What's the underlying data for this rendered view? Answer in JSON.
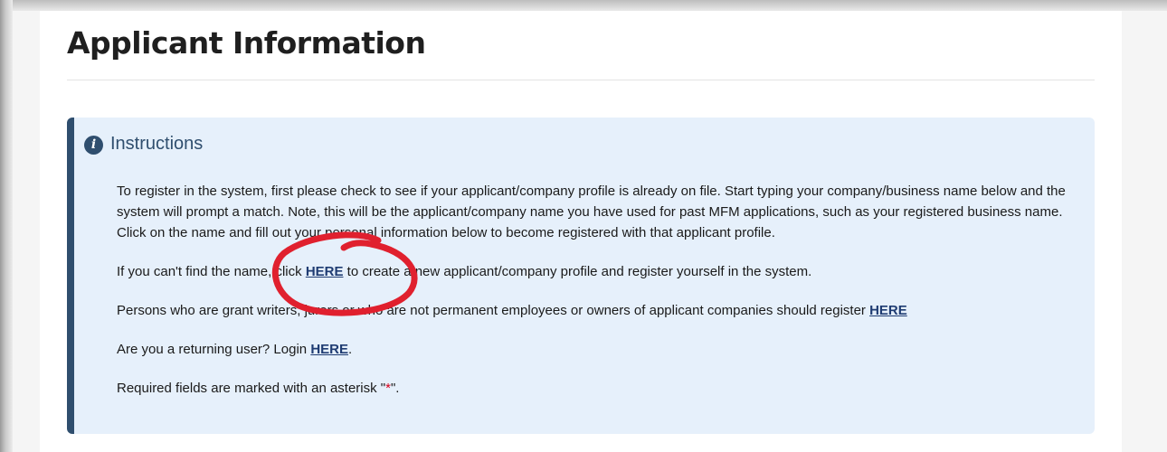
{
  "page": {
    "title": "Applicant Information"
  },
  "instructions": {
    "icon": "info-circle-icon",
    "heading": "Instructions",
    "paragraph1": "To register in the system, first please check to see if your applicant/company profile is already on file. Start typing your company/business name below and the system will prompt a match. Note, this will be the applicant/company name you have used for past MFM applications, such as your registered business name. Click on the name and fill out your personal information below to become registered with that applicant profile.",
    "paragraph2": {
      "before": "If you can't find the name, click ",
      "link": "HERE",
      "after": " to create a new applicant/company profile and register yourself in the system."
    },
    "paragraph3": {
      "before": "Persons who are grant writers, jurors or who are not permanent employees or owners of applicant companies should register ",
      "link": "HERE"
    },
    "paragraph4": {
      "before": "Are you a returning user? Login ",
      "link": "HERE",
      "after": "."
    },
    "paragraph5": {
      "before": "Required fields are marked with an asterisk \"",
      "star": "*",
      "after": "\"."
    }
  },
  "colors": {
    "alert_background": "#e6f0fb",
    "alert_accent": "#2f4e6e",
    "link": "#1f3c72",
    "asterisk": "#d9001b",
    "annotation": "#e0202e"
  }
}
